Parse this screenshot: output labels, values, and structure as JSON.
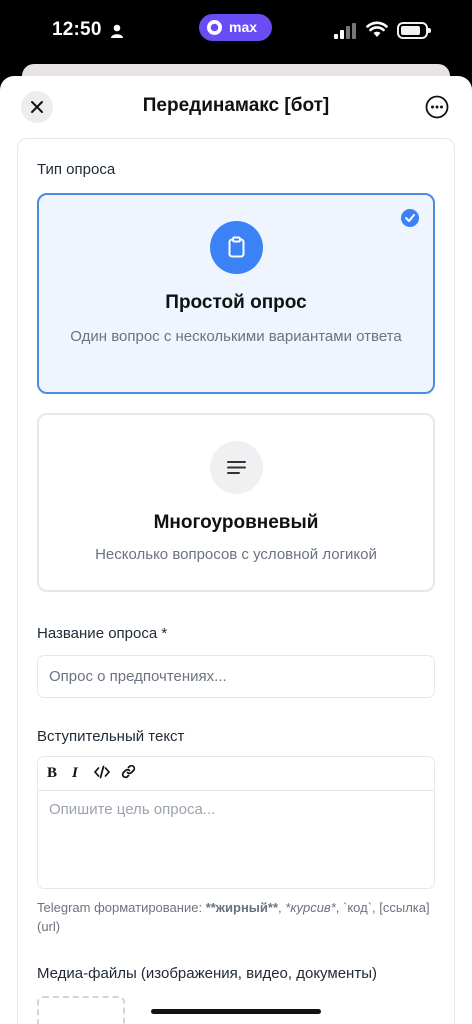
{
  "status_bar": {
    "time": "12:50",
    "app_pill": "max"
  },
  "header": {
    "title": "Перединамакс [бот]"
  },
  "poll_type": {
    "label": "Тип опроса",
    "options": [
      {
        "title": "Простой опрос",
        "description": "Один вопрос с несколькими вариантами ответа",
        "selected": true,
        "icon": "clipboard-icon"
      },
      {
        "title": "Многоуровневый",
        "description": "Несколько вопросов с условной логикой",
        "selected": false,
        "icon": "lines-icon"
      }
    ]
  },
  "poll_name": {
    "label": "Название опроса *",
    "placeholder": "Опрос о предпочтениях..."
  },
  "intro_text": {
    "label": "Вступительный текст",
    "toolbar": {
      "bold": "B",
      "italic": "I"
    },
    "placeholder": "Опишите цель опроса...",
    "help_prefix": "Telegram форматирование: ",
    "help_bold": "**жирный**",
    "help_sep1": ", ",
    "help_italic": "*курсив*",
    "help_rest": ", `код`, [ссылка](url)"
  },
  "media": {
    "label": "Медиа-файлы (изображения, видео, документы)"
  },
  "colors": {
    "accent": "#3b82f6",
    "selected_bg": "#eef5ff",
    "pill": "#6a4cf5"
  }
}
